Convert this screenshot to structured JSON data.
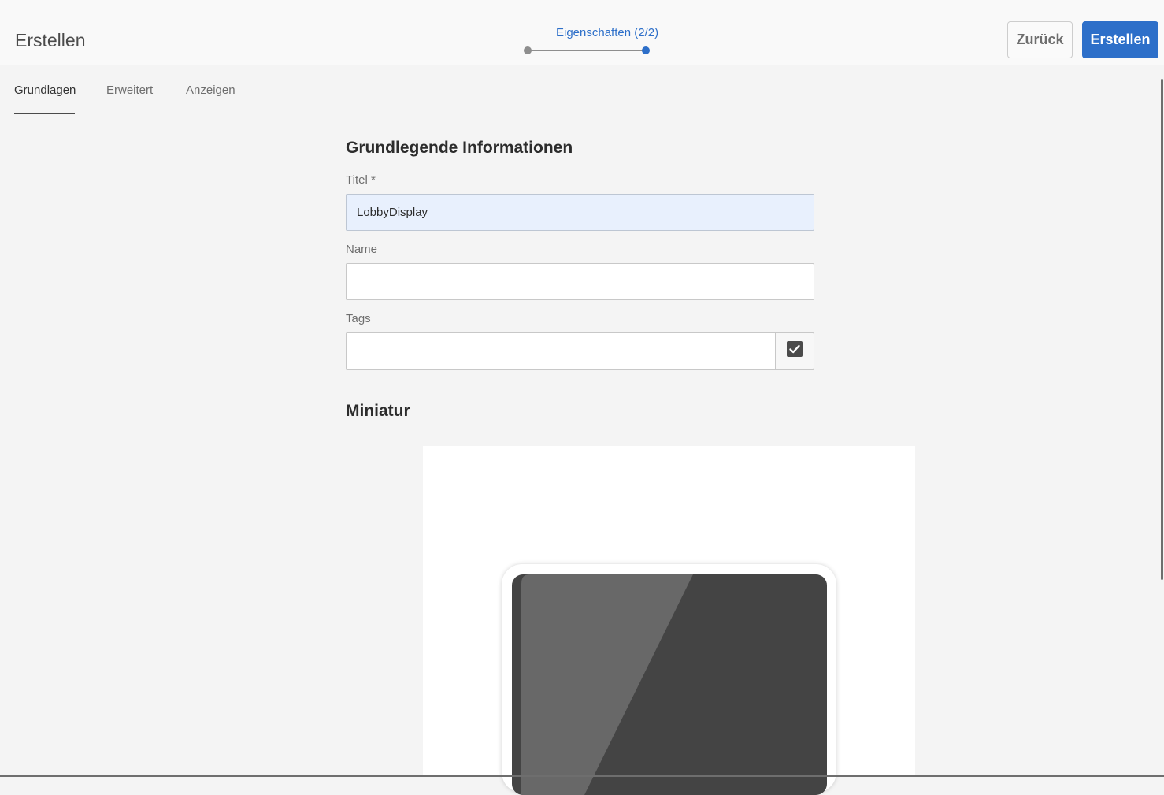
{
  "header": {
    "title": "Erstellen",
    "step_label": "Eigenschaften (2/2)",
    "back_label": "Zurück",
    "create_label": "Erstellen"
  },
  "tabs": [
    {
      "label": "Grundlagen",
      "active": true
    },
    {
      "label": "Erweitert",
      "active": false
    },
    {
      "label": "Anzeigen",
      "active": false
    }
  ],
  "form": {
    "section_title": "Grundlegende Informationen",
    "title_label": "Titel *",
    "title_value": "LobbyDisplay",
    "name_label": "Name",
    "name_value": "",
    "tags_label": "Tags",
    "tags_value": "",
    "tags_icon": "checkbox-checked-icon"
  },
  "thumbnail": {
    "section_title": "Miniatur",
    "image_icon": "tablet-device-icon"
  },
  "colors": {
    "accent": "#2d6fc9",
    "background": "#f4f4f4",
    "input_filled": "#e8f0fd"
  }
}
